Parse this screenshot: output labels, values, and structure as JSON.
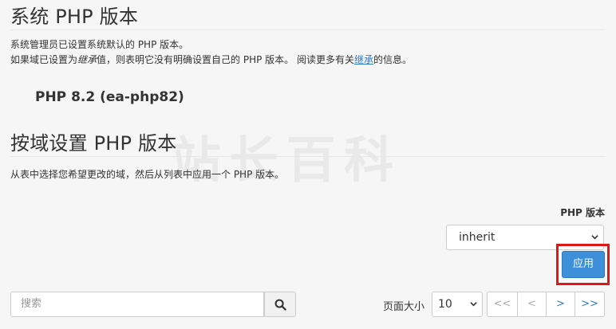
{
  "watermark": "站长百科",
  "system_section": {
    "title": "系统 PHP 版本",
    "desc1": "系统管理员已设置系统默认的 PHP 版本。",
    "desc2_before": "如果域已设置为",
    "desc2_italic": "继承",
    "desc2_middle": "值，则表明它没有明确设置自己的 PHP 版本。 阅读更多有关",
    "desc2_link": "继承",
    "desc2_after": "的信息。",
    "version": "PHP 8.2 (ea-php82)"
  },
  "domain_section": {
    "title": "按域设置 PHP 版本",
    "desc": "从表中选择您希望更改的域，然后从列表中应用一个 PHP 版本。",
    "php_version_label": "PHP 版本",
    "php_version_selected": "inherit",
    "apply_label": "应用",
    "highlight_color": "#e01717"
  },
  "table_controls": {
    "search_placeholder": "搜索",
    "page_size_label": "页面大小",
    "page_size_selected": "10",
    "pager": {
      "first": "<<",
      "prev": "<",
      "next": ">",
      "last": ">>"
    }
  },
  "colors": {
    "accent": "#3d8fd9",
    "link": "#2b7bbf",
    "background": "#f6f6f6"
  },
  "icons": {
    "search": "search-icon",
    "dropdown": "chevron-down-icon"
  }
}
